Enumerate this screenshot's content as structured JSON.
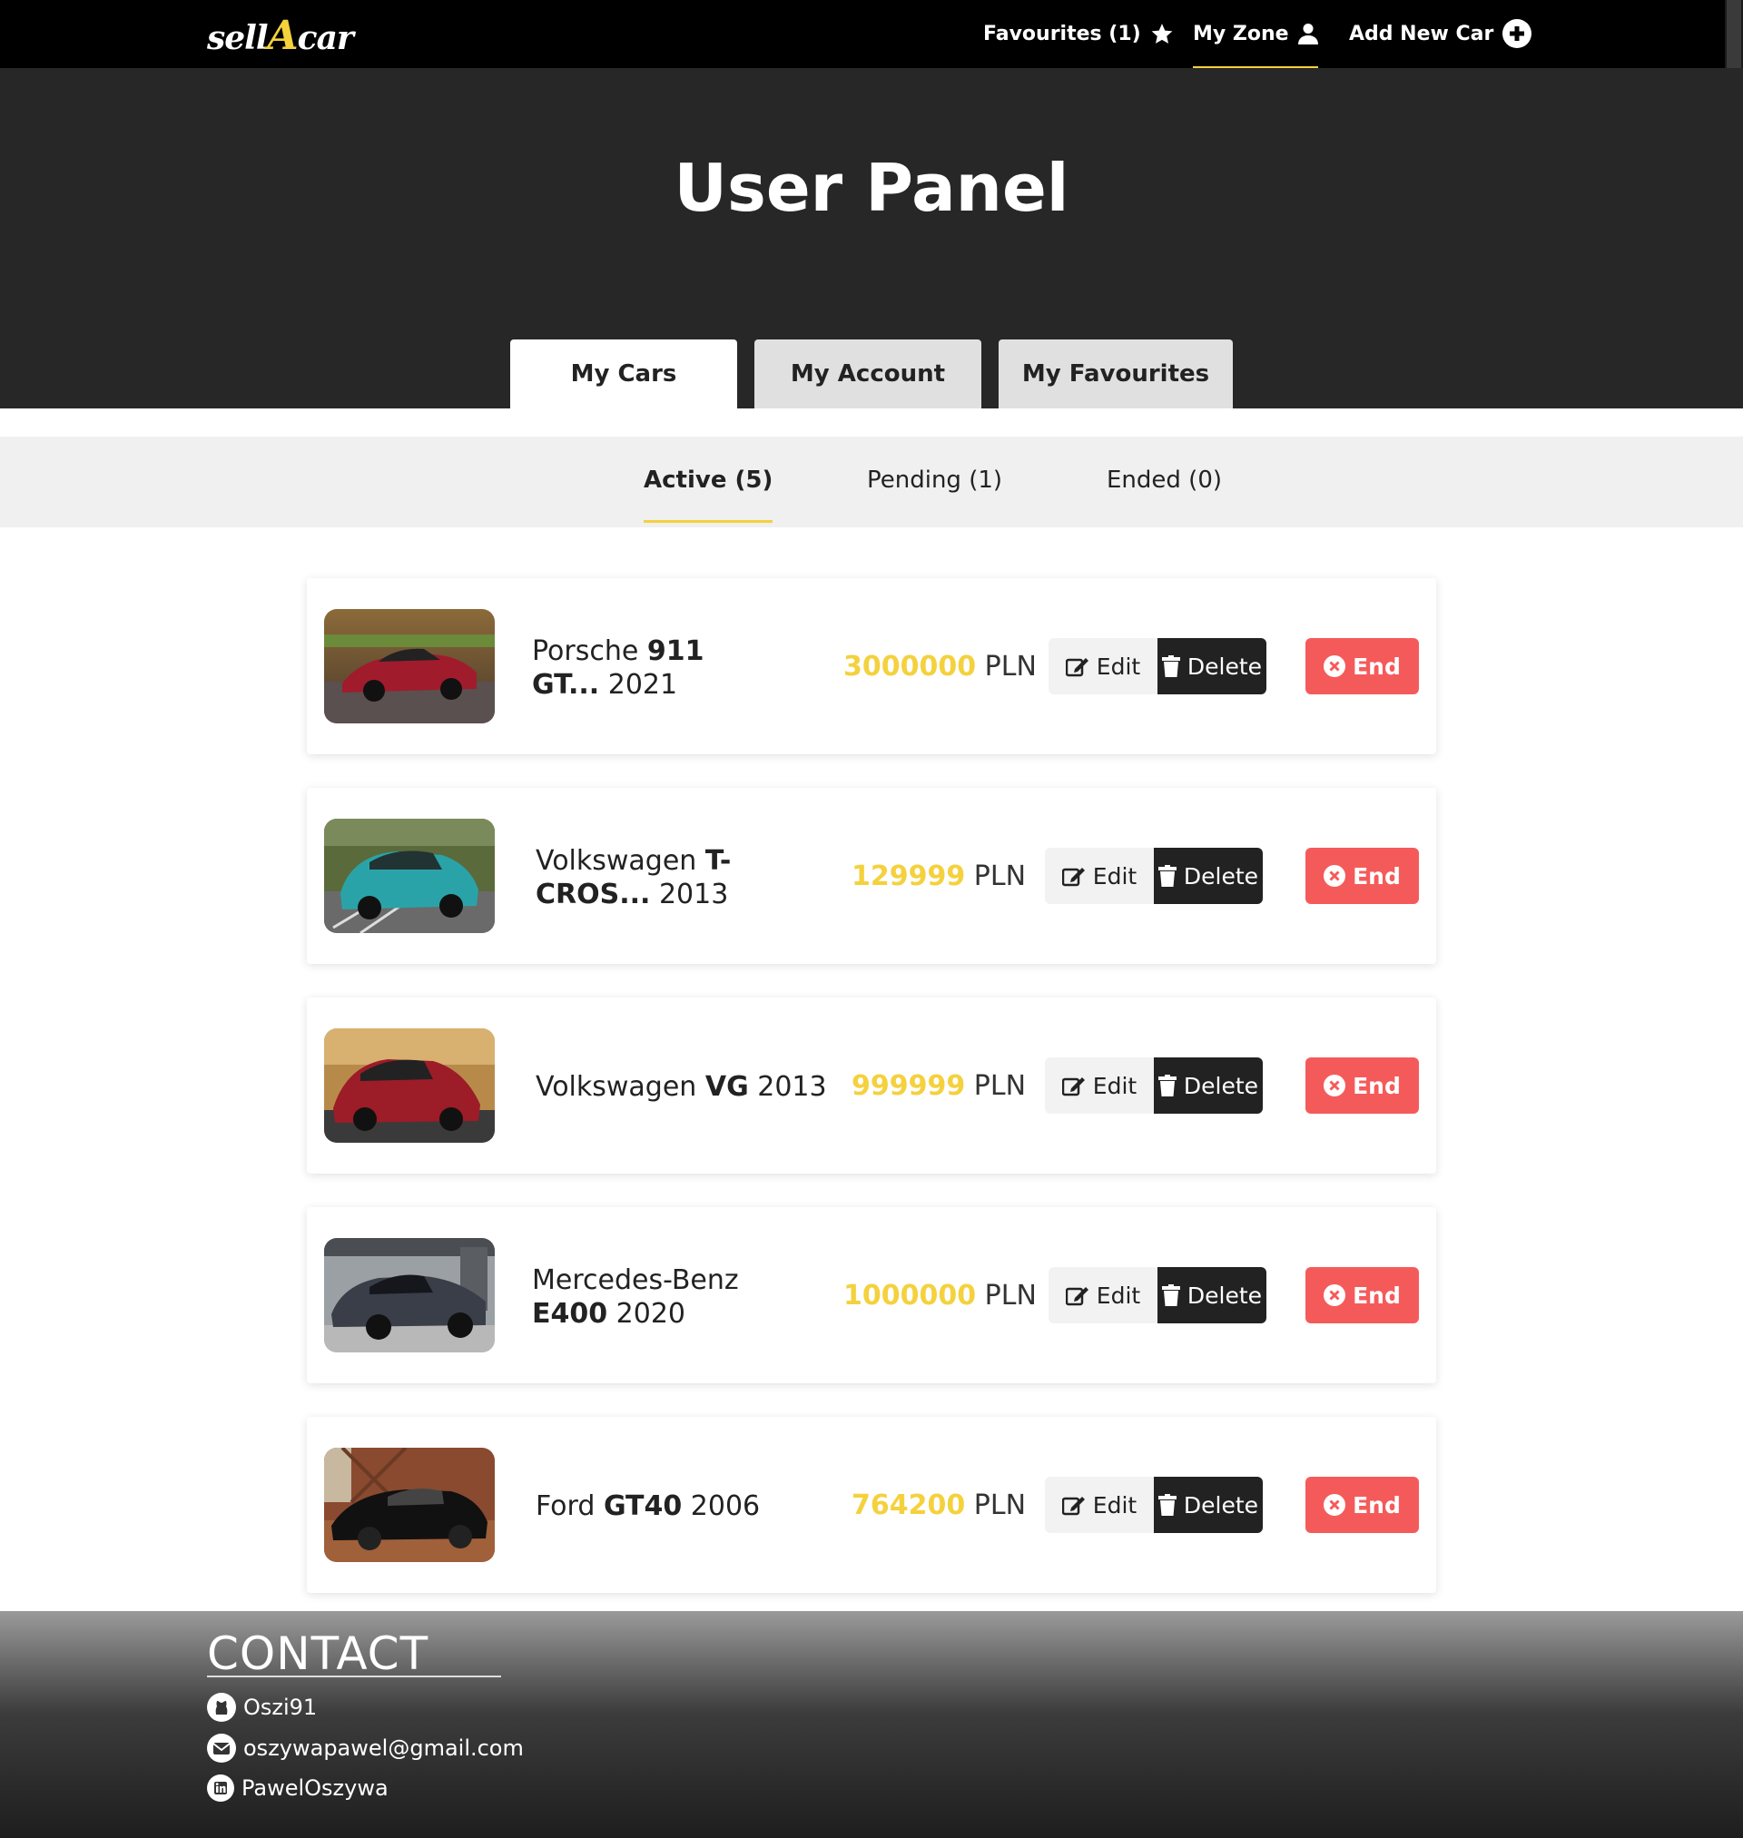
{
  "brand": {
    "prefix": "sell",
    "accent": "A",
    "suffix": "car"
  },
  "nav": {
    "favourites": "Favourites (1)",
    "my_zone": "My Zone",
    "add_new_car": "Add New Car"
  },
  "hero": {
    "title": "User Panel"
  },
  "tabs": [
    {
      "label": "My Cars",
      "active": true
    },
    {
      "label": "My Account",
      "active": false
    },
    {
      "label": "My Favourites",
      "active": false
    }
  ],
  "subtabs": [
    {
      "label": "Active (5)",
      "active": true
    },
    {
      "label": "Pending (1)",
      "active": false
    },
    {
      "label": "Ended (0)",
      "active": false
    }
  ],
  "cars": [
    {
      "make": "Porsche ",
      "model": "911 GT...",
      "year": " 2021",
      "price": "3000000",
      "currency": " PLN"
    },
    {
      "make": "Volkswagen ",
      "model": "T-CROS...",
      "year": " 2013",
      "price": "129999",
      "currency": " PLN"
    },
    {
      "make": "Volkswagen ",
      "model": "VG",
      "year": " 2013",
      "price": "999999",
      "currency": " PLN"
    },
    {
      "make": "Mercedes-Benz ",
      "model": "E400",
      "year": " 2020",
      "price": "1000000",
      "currency": " PLN"
    },
    {
      "make": "Ford ",
      "model": "GT40",
      "year": " 2006",
      "price": "764200",
      "currency": " PLN"
    }
  ],
  "actions": {
    "edit": "Edit",
    "delete": "Delete",
    "end": "End"
  },
  "footer": {
    "title": "CONTACT",
    "github": "Oszi91",
    "email": "oszywapawel@gmail.com",
    "linkedin": "PawelOszywa"
  },
  "colors": {
    "accent": "#f4d13d",
    "danger": "#f55a5a",
    "dark": "#272727"
  }
}
